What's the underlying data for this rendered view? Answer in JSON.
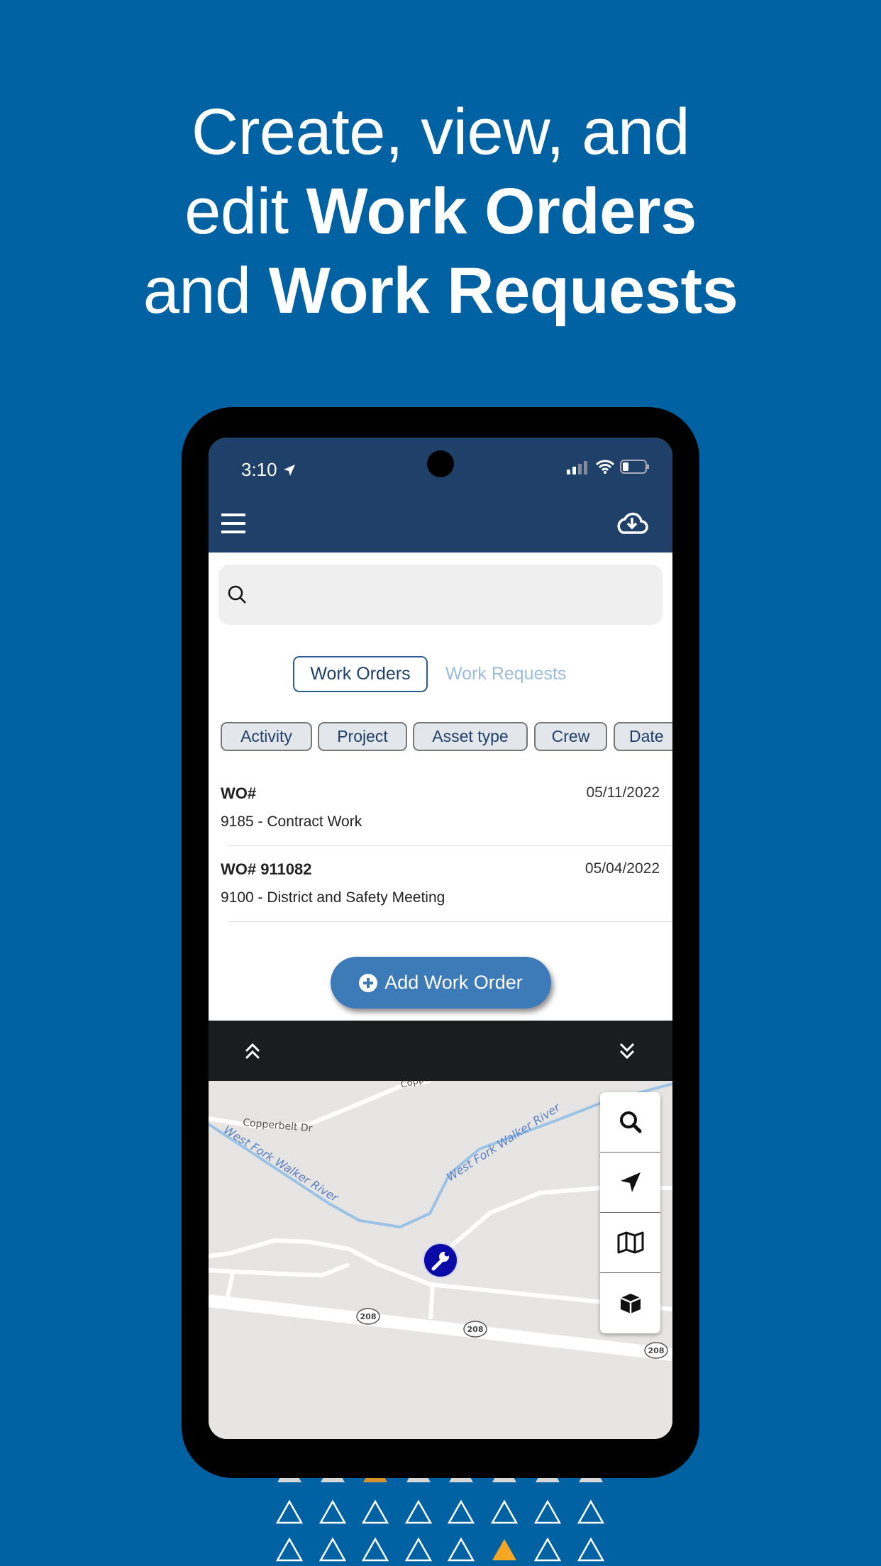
{
  "headline": {
    "line1": "Create, view, and",
    "line2_regular": "edit ",
    "line2_bold": "Work Orders",
    "line3_regular": "and ",
    "line3_bold": "Work Requests"
  },
  "status_bar": {
    "time": "3:10"
  },
  "header": {
    "menu_icon": "hamburger-icon",
    "sync_icon": "cloud-download-icon"
  },
  "search": {
    "placeholder": "",
    "value": ""
  },
  "tabs": [
    {
      "label": "Work Orders",
      "active": true
    },
    {
      "label": "Work Requests",
      "active": false
    }
  ],
  "filters": [
    "Activity",
    "Project",
    "Asset type",
    "Crew",
    "Date"
  ],
  "work_orders": [
    {
      "number": "WO#",
      "date": "05/11/2022",
      "activity": "9185 - Contract Work"
    },
    {
      "number": "WO# 911082",
      "date": "05/04/2022",
      "activity": "9100 - District and Safety Meeting"
    }
  ],
  "add_button": {
    "label": "Add Work Order"
  },
  "map": {
    "labels": {
      "road1": "Copperbelt Dr",
      "road2": "Copperb",
      "river_left": "West Fork Walker River",
      "river_right": "West Fork Walker River",
      "route": "208"
    },
    "controls": [
      "search-icon",
      "navigate-icon",
      "map-icon",
      "cube-icon"
    ]
  },
  "colors": {
    "background": "#0062a3",
    "header": "#1f4068",
    "accent": "#3d7ab8",
    "marker": "#0a0aa8",
    "triangle_highlight": "#f5a623"
  }
}
